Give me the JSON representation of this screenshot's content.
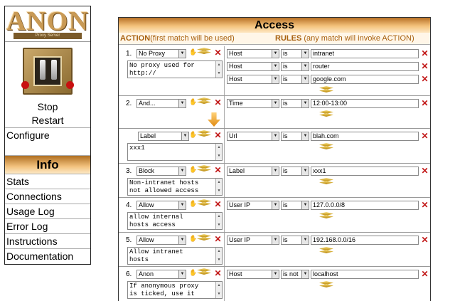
{
  "sidebar": {
    "logo_text": "ANON",
    "logo_subtitle": "Proxy Server",
    "stop_label": "Stop",
    "restart_label": "Restart",
    "configure_label": "Configure",
    "info_heading": "Info",
    "info_items": [
      "Stats",
      "Connections",
      "Usage Log",
      "Error Log",
      "Instructions",
      "Documentation"
    ]
  },
  "main": {
    "title": "Access",
    "action_header_bold": "ACTION",
    "action_header_note": "(first match will be used)",
    "rules_header_bold": "RULES",
    "rules_header_note": "(any match will invoke ACTION)"
  },
  "rules": [
    {
      "num": "1.",
      "action": "No Proxy",
      "comment": [
        "No proxy used for",
        "http://"
      ],
      "conditions": [
        {
          "field": "Host",
          "op": "is",
          "value": "intranet"
        },
        {
          "field": "Host",
          "op": "is",
          "value": "router"
        },
        {
          "field": "Host",
          "op": "is",
          "value": "google.com"
        }
      ]
    },
    {
      "num": "2.",
      "action": "And...",
      "conditions": [
        {
          "field": "Time",
          "op": "is",
          "value": "12:00-13:00"
        }
      ]
    },
    {
      "num": "",
      "action": "Label",
      "comment": [
        "xxx1"
      ],
      "conditions": [
        {
          "field": "Url",
          "op": "is",
          "value": "blah.com"
        }
      ]
    },
    {
      "num": "3.",
      "action": "Block",
      "comment": [
        "Non-intranet hosts",
        "not allowed access"
      ],
      "conditions": [
        {
          "field": "Label",
          "op": "is",
          "value": "xxx1"
        }
      ]
    },
    {
      "num": "4.",
      "action": "Allow",
      "comment": [
        "allow internal",
        "hosts access"
      ],
      "conditions": [
        {
          "field": "User IP",
          "op": "is",
          "value": "127.0.0.0/8"
        }
      ]
    },
    {
      "num": "5.",
      "action": "Allow",
      "comment": [
        "Allow intranet",
        "hosts"
      ],
      "conditions": [
        {
          "field": "User IP",
          "op": "is",
          "value": "192.168.0.0/16"
        }
      ]
    },
    {
      "num": "6.",
      "action": "Anon",
      "comment": [
        "If anonymous proxy",
        "is ticked, use it"
      ],
      "conditions": [
        {
          "field": "Host",
          "op": "is not",
          "value": "localhost"
        }
      ]
    }
  ],
  "icons": {
    "delete": "close-icon",
    "drag": "hand-icon",
    "add": "layers-icon",
    "chain": "arrow-down-icon"
  },
  "colors": {
    "accent_dark": "#b87227",
    "accent_light": "#fde7c2",
    "header_text": "#a8610f",
    "delete_red": "#c21818"
  }
}
